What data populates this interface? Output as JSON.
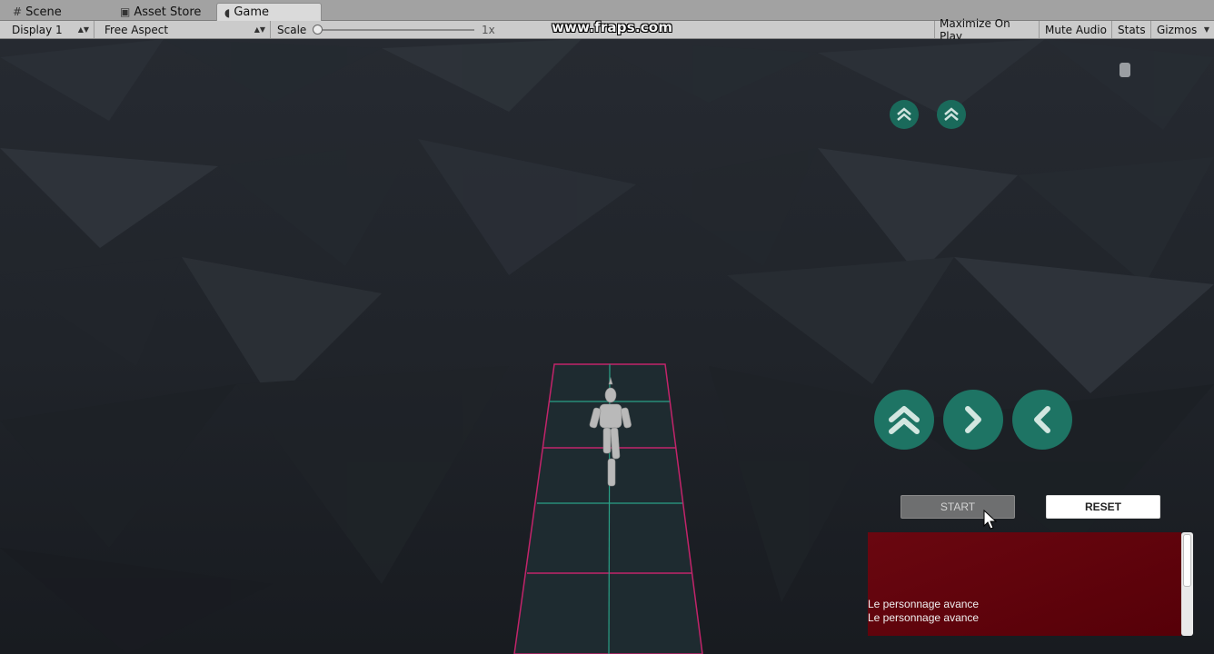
{
  "tabs": [
    {
      "icon": "grid-icon",
      "label": "Scene"
    },
    {
      "icon": "bag-icon",
      "label": "Asset Store"
    },
    {
      "icon": "pacman-icon",
      "label": "Game"
    }
  ],
  "toolbar": {
    "display": "Display 1",
    "aspect": "Free Aspect",
    "scale_label": "Scale",
    "scale_value": "1x",
    "maximize": "Maximize On Play",
    "mute": "Mute Audio",
    "stats": "Stats",
    "gizmos": "Gizmos"
  },
  "watermark": "www.fraps.com",
  "game_ui": {
    "start": "START",
    "reset": "RESET",
    "log_lines": [
      "Le personnage avance",
      "Le personnage avance"
    ]
  },
  "colors": {
    "button_teal": "#1e7464",
    "log_red": "#6a0710",
    "tile_pink": "#c2246a",
    "tile_teal": "#2aa086"
  }
}
